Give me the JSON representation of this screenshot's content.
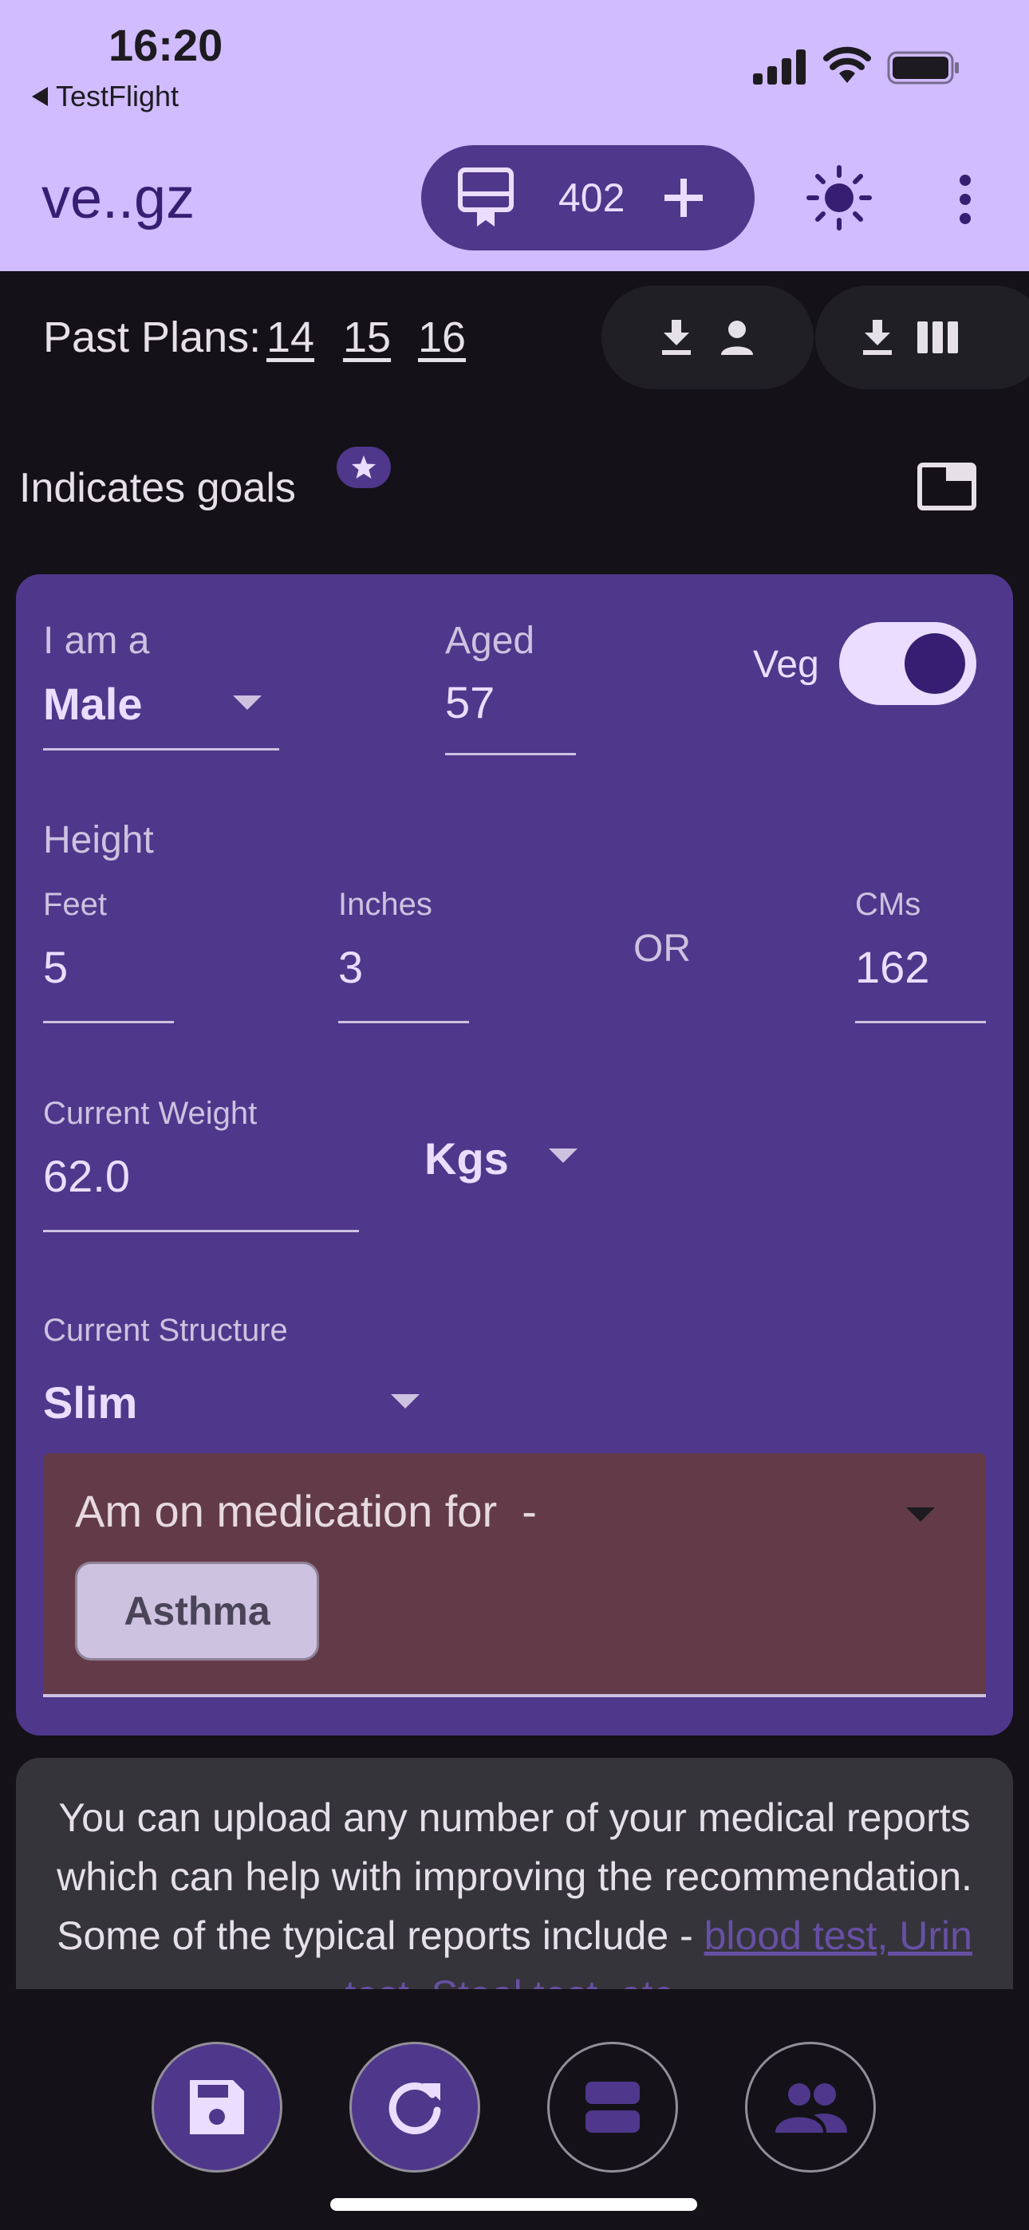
{
  "status_bar": {
    "time": "16:20",
    "back_app": "TestFlight"
  },
  "app_bar": {
    "title": "ve..gz",
    "plan_count": "402"
  },
  "past_plans": {
    "label": "Past Plans:",
    "plans": [
      "14",
      "15",
      "16"
    ]
  },
  "goals": {
    "text": "Indicates goals"
  },
  "profile": {
    "gender": {
      "label": "I am a",
      "value": "Male"
    },
    "age": {
      "label": "Aged",
      "value": "57"
    },
    "veg": {
      "label": "Veg",
      "on": true
    },
    "height": {
      "title": "Height",
      "feet": {
        "label": "Feet",
        "value": "5"
      },
      "inches": {
        "label": "Inches",
        "value": "3"
      },
      "or_text": "OR",
      "cms": {
        "label": "CMs",
        "value": "162"
      }
    },
    "weight": {
      "label": "Current Weight",
      "value": "62.0",
      "unit": "Kgs"
    },
    "structure": {
      "label": "Current Structure",
      "value": "Slim"
    },
    "medication": {
      "label": "Am on medication for  -",
      "chips": [
        "Asthma"
      ]
    }
  },
  "reports": {
    "line1": "You can upload any number of your medical reports which can help with improving the recommendation. Some of the typical reports include - ",
    "links": "blood test, Urin test, Stool test, etc."
  },
  "colors": {
    "app_bar_bg": "#d0bcff",
    "primary_container": "#4f378b",
    "background": "#141218",
    "medication_bg": "#633b48"
  },
  "icons": {
    "plan": "card-membership-icon",
    "add": "plus-icon",
    "theme": "brightness-icon",
    "menu": "more-vert-icon",
    "download": "download-icon",
    "person": "person-icon",
    "columns": "view-column-icon",
    "star": "star-icon",
    "window": "window-icon",
    "nav": [
      "save-icon",
      "refresh-icon",
      "view-agenda-icon",
      "people-icon"
    ]
  }
}
